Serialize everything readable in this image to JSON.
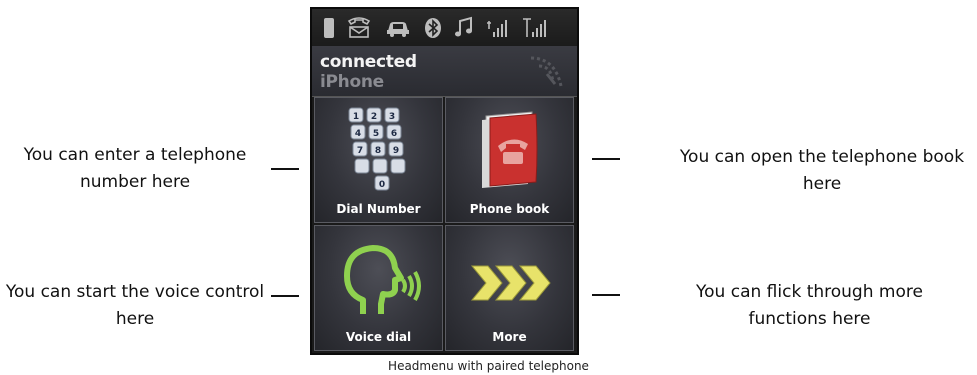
{
  "device": {
    "status_icons": [
      "battery-icon",
      "phone-message-icon",
      "car-icon",
      "bluetooth-icon",
      "music-note-icon",
      "signal-strength-icon",
      "network-signal-icon"
    ],
    "header": {
      "status": "connected",
      "device_name": "iPhone"
    },
    "tiles": [
      {
        "label": "Dial Number",
        "icon": "keypad-icon"
      },
      {
        "label": "Phone book",
        "icon": "phone-book-icon"
      },
      {
        "label": "Voice dial",
        "icon": "voice-head-icon"
      },
      {
        "label": "More",
        "icon": "chevrons-icon"
      }
    ]
  },
  "annotations": {
    "dial": "You can enter a telephone number here",
    "phonebook": "You can open the telephone book here",
    "voice": "You can start the voice control here",
    "more": "You can flick through more functions here"
  },
  "caption": "Headmenu with paired telephone",
  "colors": {
    "tile_bg": "#34353c",
    "icon_green": "#8fd14f",
    "chevron_yellow": "#e8e36a",
    "book_red": "#c9312f"
  }
}
